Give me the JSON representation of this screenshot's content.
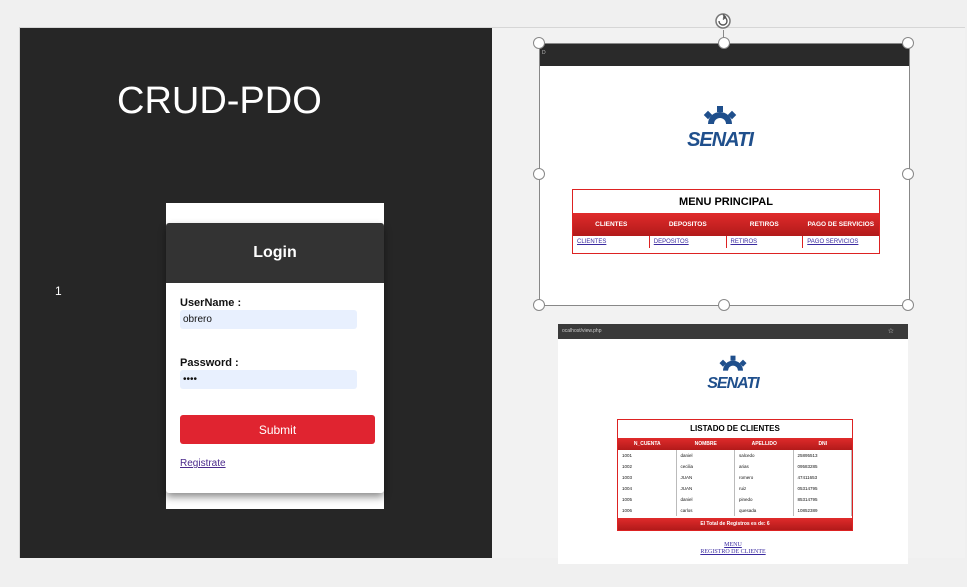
{
  "slide": {
    "title": "CRUD-PDO",
    "number": "1"
  },
  "login": {
    "header": "Login",
    "username_label": "UserName :",
    "username_value": "obrero",
    "password_label": "Password :",
    "password_value": "••••",
    "submit_label": "Submit",
    "register_link": "Registrate"
  },
  "menu_screenshot": {
    "tab_text": "D",
    "logo_text": "SENATI",
    "menu_title": "MENU PRINCIPAL",
    "columns": [
      "CLIENTES",
      "DEPOSITOS",
      "RETIROS",
      "PAGO DE SERVICIOS"
    ],
    "links": [
      "CLIENTES",
      "DEPOSITOS",
      "RETIROS",
      "PAGO SERVICIOS"
    ]
  },
  "list_screenshot": {
    "address": "ocalhost/view.php",
    "logo_text": "SENATI",
    "list_title": "LISTADO DE CLIENTES",
    "columns": [
      "N_CUENTA",
      "NOMBRE",
      "APELLIDO",
      "DNI"
    ],
    "rows": [
      [
        "1001",
        "daniel",
        "salcedo",
        "25895513"
      ],
      [
        "1002",
        "cecilia",
        "arias",
        "09583285"
      ],
      [
        "1003",
        "JUAN",
        "romero",
        "47411653"
      ],
      [
        "1004",
        "JUAN",
        "ruiz",
        "05314795"
      ],
      [
        "1005",
        "daniel",
        "pinedo",
        "85314795"
      ],
      [
        "1006",
        "carlos",
        "quesada",
        "10852389"
      ]
    ],
    "total": "El Total de Registros es de: 6",
    "links": [
      "MENU",
      "REGISTRO DE CLIENTE"
    ]
  },
  "colors": {
    "dark_panel": "#262626",
    "accent_red": "#e02430",
    "senati_blue": "#1f4f8c"
  }
}
